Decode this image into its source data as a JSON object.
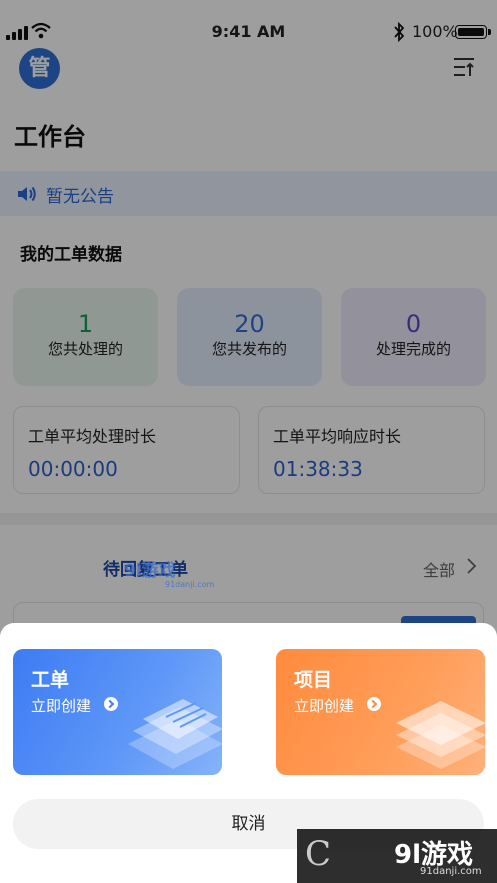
{
  "status_bar": {
    "time": "9:41 AM",
    "battery": "100%"
  },
  "header": {
    "avatar_char": "管",
    "title": "工作台"
  },
  "notice": {
    "text": "暂无公告"
  },
  "stats_section": {
    "title": "我的工单数据",
    "cards": [
      {
        "value": "1",
        "label": "您共处理的"
      },
      {
        "value": "20",
        "label": "您共发布的"
      },
      {
        "value": "0",
        "label": "处理完成的"
      }
    ],
    "time_cards": [
      {
        "label": "工单平均处理时长",
        "value": "00:00:00"
      },
      {
        "label": "工单平均响应时长",
        "value": "01:38:33"
      }
    ]
  },
  "pending": {
    "title": "待回复工单",
    "view_all": "全部"
  },
  "sheet": {
    "cards": [
      {
        "title": "工单",
        "subtitle": "立即创建"
      },
      {
        "title": "项目",
        "subtitle": "立即创建"
      }
    ],
    "cancel_label": "取消"
  },
  "watermarks": {
    "brand": "9l游戏",
    "domain": "91danji.com"
  },
  "colors": {
    "primary": "#2f6fd6",
    "accent_orange": "#ff8a3d",
    "green": "#1e9a5a",
    "purple": "#5a4bc8"
  }
}
